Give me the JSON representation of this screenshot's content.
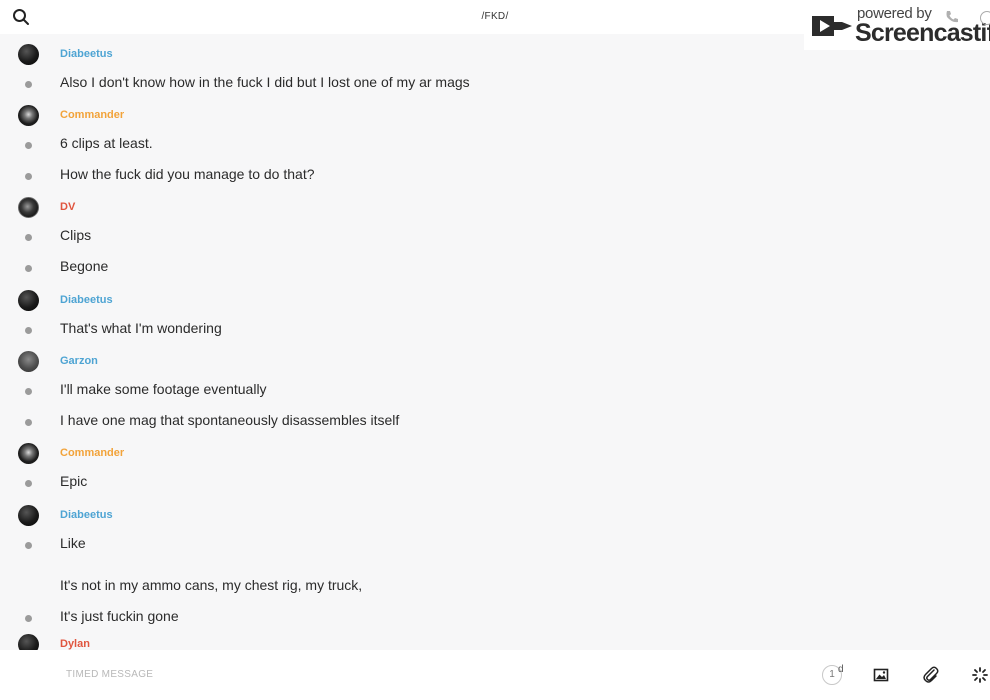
{
  "header": {
    "chat_title": "/FKD/"
  },
  "watermark": {
    "powered_by": "powered by",
    "brand": "Screencastify"
  },
  "colors": {
    "Diabeetus": "#4ea4d3",
    "Commander": "#f2a33a",
    "DV": "#e0553f",
    "Garzon": "#4ea4d3",
    "Dylan": "#e0553f"
  },
  "messages": [
    {
      "sender": "Diabeetus",
      "lines": [
        "Also I don't know how in the fuck I did but I lost one of my ar mags"
      ]
    },
    {
      "sender": "Commander",
      "lines": [
        "6 clips at least.",
        "How the fuck did you manage to do that?"
      ]
    },
    {
      "sender": "DV",
      "lines": [
        "Clips",
        "Begone"
      ]
    },
    {
      "sender": "Diabeetus",
      "lines": [
        "That's what I'm wondering"
      ]
    },
    {
      "sender": "Garzon",
      "lines": [
        "I'll make some footage eventually",
        "I have one mag that spontaneously disassembles itself"
      ]
    },
    {
      "sender": "Commander",
      "lines": [
        "Epic"
      ]
    },
    {
      "sender": "Diabeetus",
      "lines": [
        "Like",
        "It's not in my ammo cans, my chest rig, my truck,",
        "It's just fuckin gone"
      ]
    },
    {
      "sender": "Dylan",
      "lines": []
    }
  ],
  "composer": {
    "placeholder": "TIMED MESSAGE",
    "timer_value": "1",
    "timer_unit": "d"
  },
  "icons": {
    "search": "search-icon",
    "image": "image-icon",
    "attach": "paperclip-icon",
    "sparkle": "sparkle-icon"
  }
}
